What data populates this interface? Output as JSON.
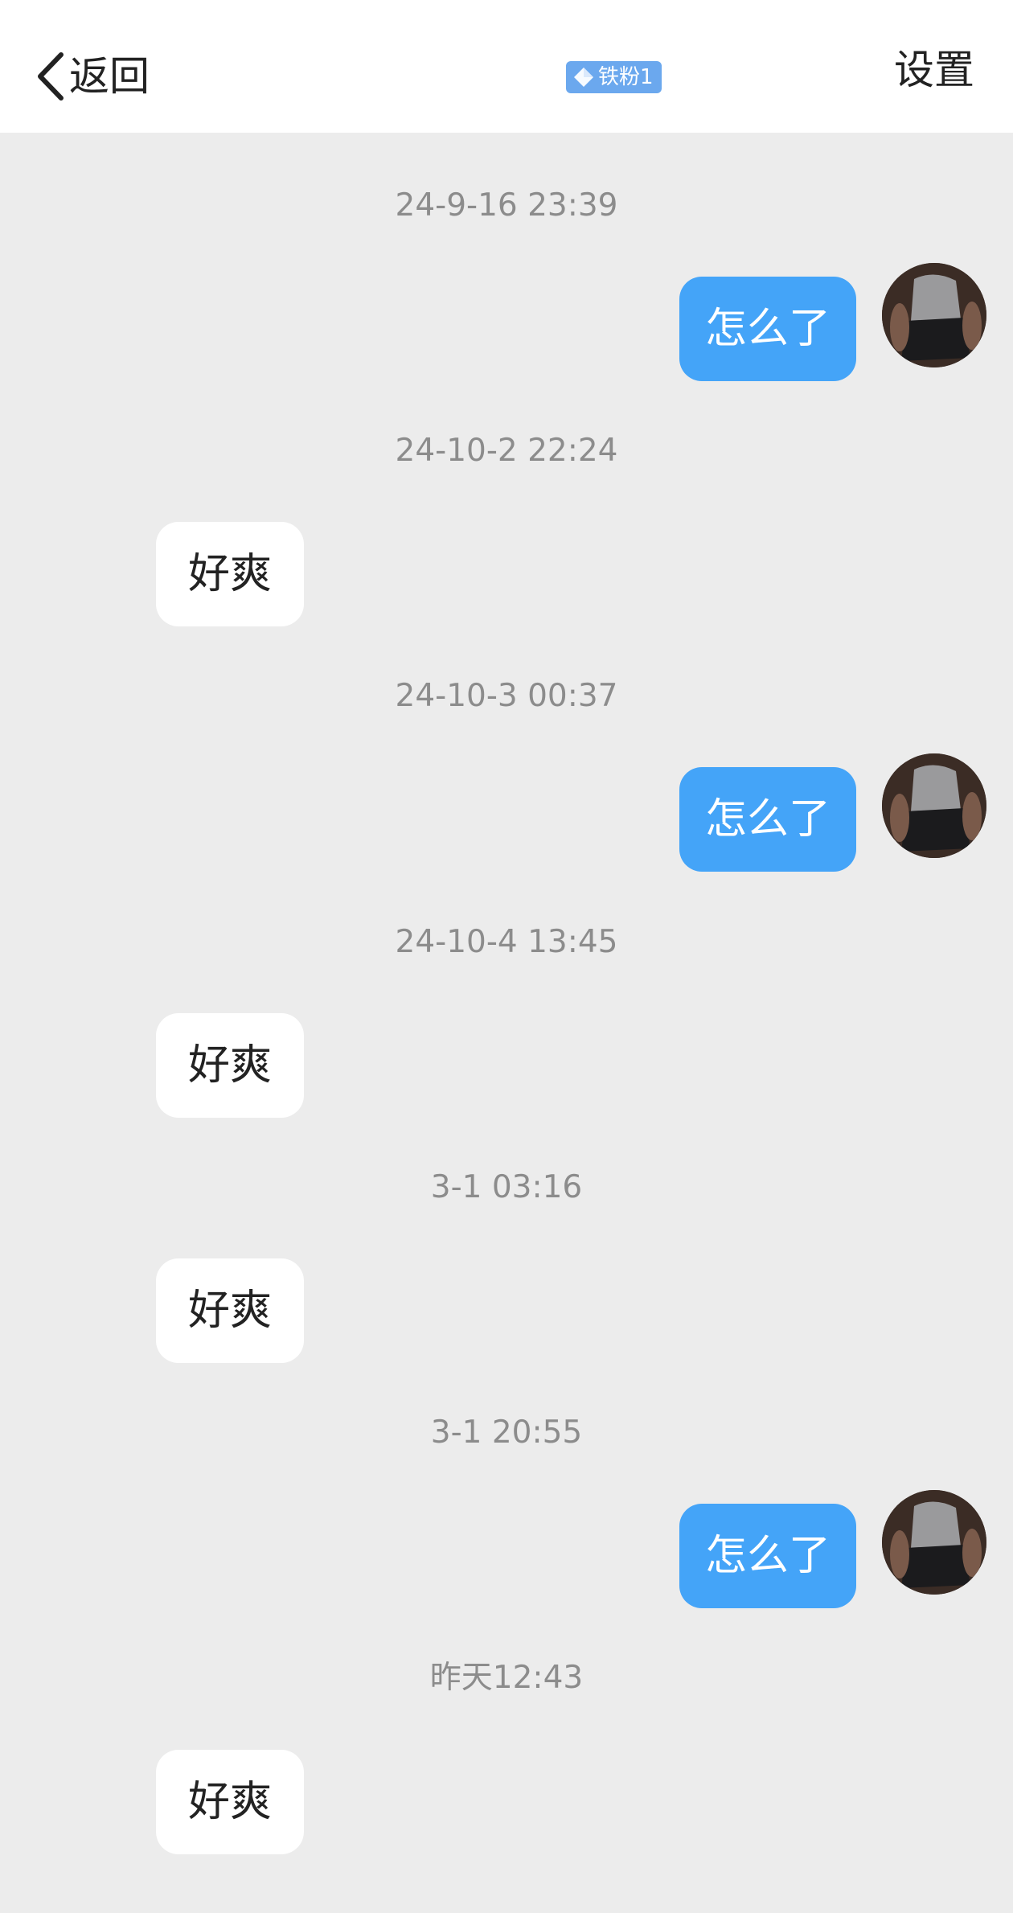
{
  "header": {
    "back_label": "返回",
    "badge_label": "铁粉1",
    "settings_label": "设置"
  },
  "messages": [
    {
      "time": "24-9-16 23:39",
      "text": "怎么了",
      "side": "outgoing"
    },
    {
      "time": "24-10-2 22:24",
      "text": "好爽",
      "side": "incoming"
    },
    {
      "time": "24-10-3 00:37",
      "text": "怎么了",
      "side": "outgoing"
    },
    {
      "time": "24-10-4 13:45",
      "text": "好爽",
      "side": "incoming"
    },
    {
      "time": "3-1 03:16",
      "text": "好爽",
      "side": "incoming"
    },
    {
      "time": "3-1 20:55",
      "text": "怎么了",
      "side": "outgoing"
    },
    {
      "time": "昨天12:43",
      "text": "好爽",
      "side": "incoming"
    }
  ],
  "colors": {
    "outgoing_bubble": "#44a4f8",
    "incoming_bubble": "#ffffff",
    "badge": "#6ba8ee",
    "background": "#ececec"
  },
  "icons": {
    "back": "chevron-left-icon",
    "badge": "diamond-icon"
  }
}
